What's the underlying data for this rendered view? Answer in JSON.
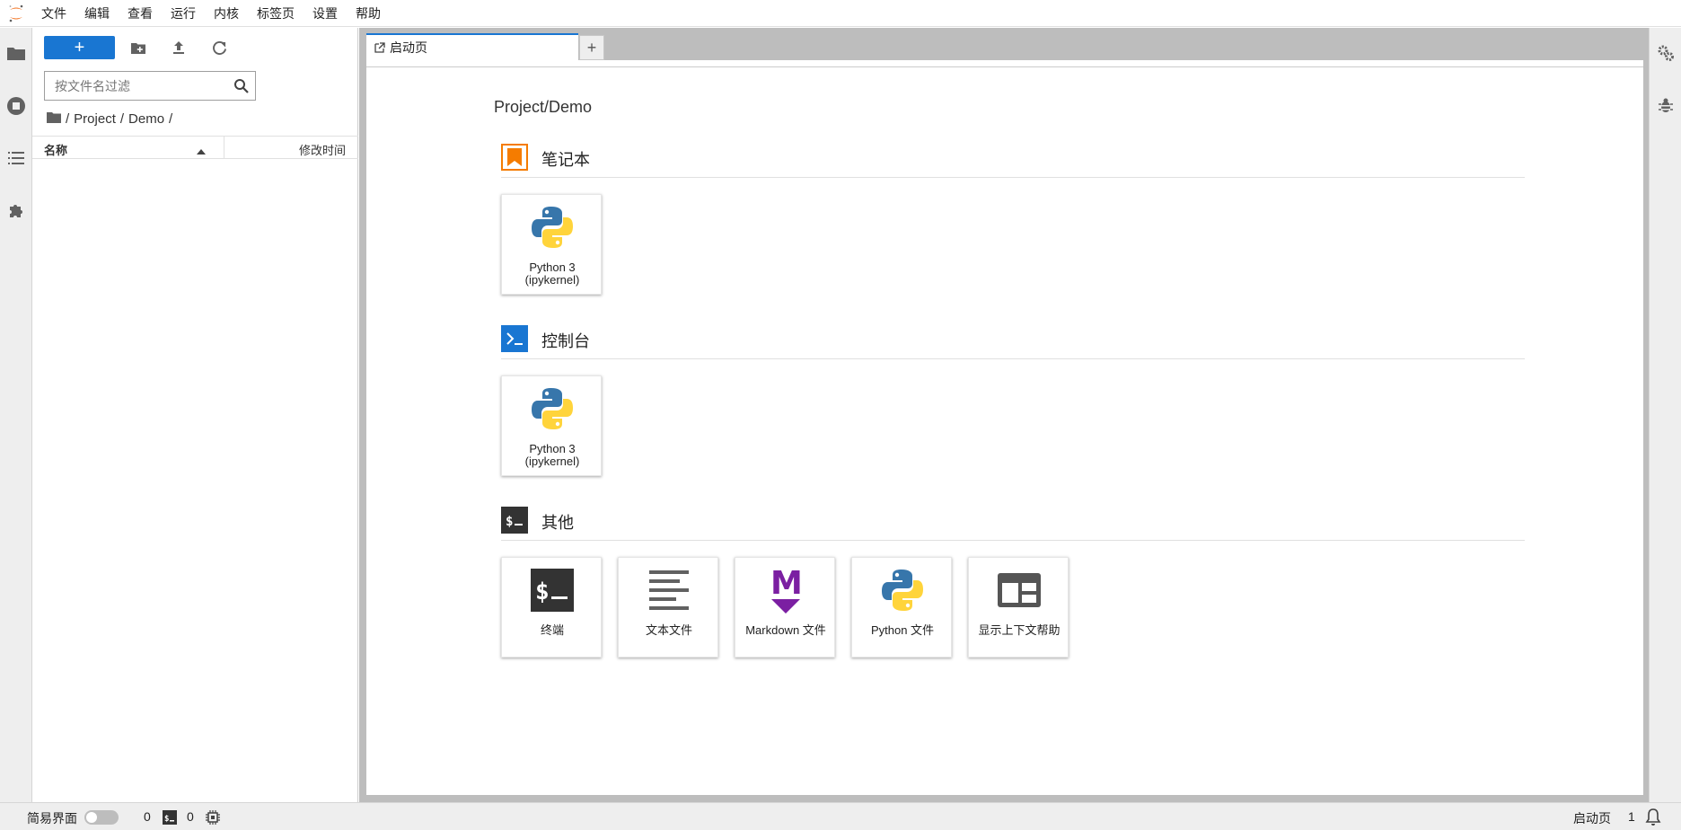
{
  "menubar": {
    "items": [
      "文件",
      "编辑",
      "查看",
      "运行",
      "内核",
      "标签页",
      "设置",
      "帮助"
    ]
  },
  "filebrowser": {
    "new_label": "+",
    "search_placeholder": "按文件名过滤",
    "breadcrumbs": [
      "/",
      "Project",
      "/",
      "Demo",
      "/"
    ],
    "columns": {
      "name": "名称",
      "modified": "修改时间"
    }
  },
  "tabs": {
    "launcher_label": "启动页",
    "add_label": "+"
  },
  "launcher": {
    "cwd": "Project/Demo",
    "sections": [
      {
        "title": "笔记本",
        "icon": "notebook-bookmark-icon",
        "color": "#f57c00",
        "cards": [
          {
            "label": "Python 3 (ipykernel)",
            "icon": "python-logo-icon"
          }
        ]
      },
      {
        "title": "控制台",
        "icon": "console-prompt-icon",
        "color": "#1976d2",
        "cards": [
          {
            "label": "Python 3 (ipykernel)",
            "icon": "python-logo-icon"
          }
        ]
      },
      {
        "title": "其他",
        "icon": "terminal-dollar-icon",
        "color": "#333333",
        "cards": [
          {
            "label": "终端",
            "icon": "terminal-icon"
          },
          {
            "label": "文本文件",
            "icon": "text-file-icon"
          },
          {
            "label": "Markdown 文件",
            "icon": "markdown-icon"
          },
          {
            "label": "Python 文件",
            "icon": "python-logo-icon"
          },
          {
            "label": "显示上下文帮助",
            "icon": "context-help-icon"
          }
        ]
      }
    ]
  },
  "statusbar": {
    "simple_mode_label": "简易界面",
    "kernels_count": "0",
    "terminals_count": "0",
    "active_tab_label": "启动页",
    "notifications_count": "1"
  },
  "colors": {
    "accent": "#1976d2",
    "python_blue": "#3776ab",
    "python_yellow": "#ffd43b",
    "markdown_purple": "#7b1fa2",
    "jupyter_orange": "#f37626"
  }
}
